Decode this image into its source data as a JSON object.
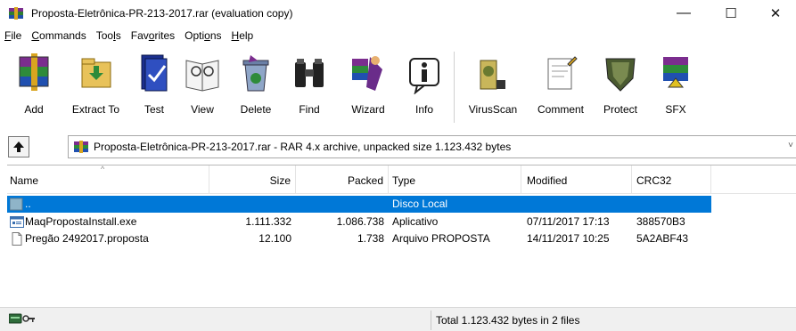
{
  "window": {
    "title": "Proposta-Eletrônica-PR-213-2017.rar (evaluation copy)",
    "minimize": "—",
    "maximize": "☐",
    "close": "✕"
  },
  "menu": [
    {
      "pre": "",
      "key": "F",
      "post": "ile"
    },
    {
      "pre": "",
      "key": "C",
      "post": "ommands"
    },
    {
      "pre": "Too",
      "key": "l",
      "post": "s"
    },
    {
      "pre": "Fav",
      "key": "o",
      "post": "rites"
    },
    {
      "pre": "Opti",
      "key": "o",
      "post": "ns"
    },
    {
      "pre": "",
      "key": "H",
      "post": "elp"
    }
  ],
  "toolbar": {
    "add": "Add",
    "extract": "Extract To",
    "test": "Test",
    "view": "View",
    "delete": "Delete",
    "find": "Find",
    "wizard": "Wizard",
    "info": "Info",
    "virusscan": "VirusScan",
    "comment": "Comment",
    "protect": "Protect",
    "sfx": "SFX"
  },
  "address": {
    "path": "Proposta-Eletrônica-PR-213-2017.rar - RAR 4.x archive, unpacked size 1.123.432 bytes"
  },
  "columns": {
    "name": "Name",
    "size": "Size",
    "packed": "Packed",
    "type": "Type",
    "modified": "Modified",
    "crc": "CRC32"
  },
  "rows": [
    {
      "name": "..",
      "size": "",
      "packed": "",
      "type": "Disco Local",
      "modified": "",
      "crc": "",
      "icon": "folder-up-icon",
      "selected": true
    },
    {
      "name": "MaqPropostaInstall.exe",
      "size": "1.111.332",
      "packed": "1.086.738",
      "type": "Aplicativo",
      "modified": "07/11/2017 17:13",
      "crc": "388570B3",
      "icon": "exe-file-icon",
      "selected": false
    },
    {
      "name": "Pregão 2492017.proposta",
      "size": "12.100",
      "packed": "1.738",
      "type": "Arquivo PROPOSTA",
      "modified": "14/11/2017 10:25",
      "crc": "5A2ABF43",
      "icon": "document-file-icon",
      "selected": false
    }
  ],
  "status": {
    "total": "Total 1.123.432 bytes in 2 files"
  },
  "colors": {
    "selection": "#0078d7",
    "accent_purple": "#6a2c8a",
    "accent_gold": "#d9a520"
  }
}
